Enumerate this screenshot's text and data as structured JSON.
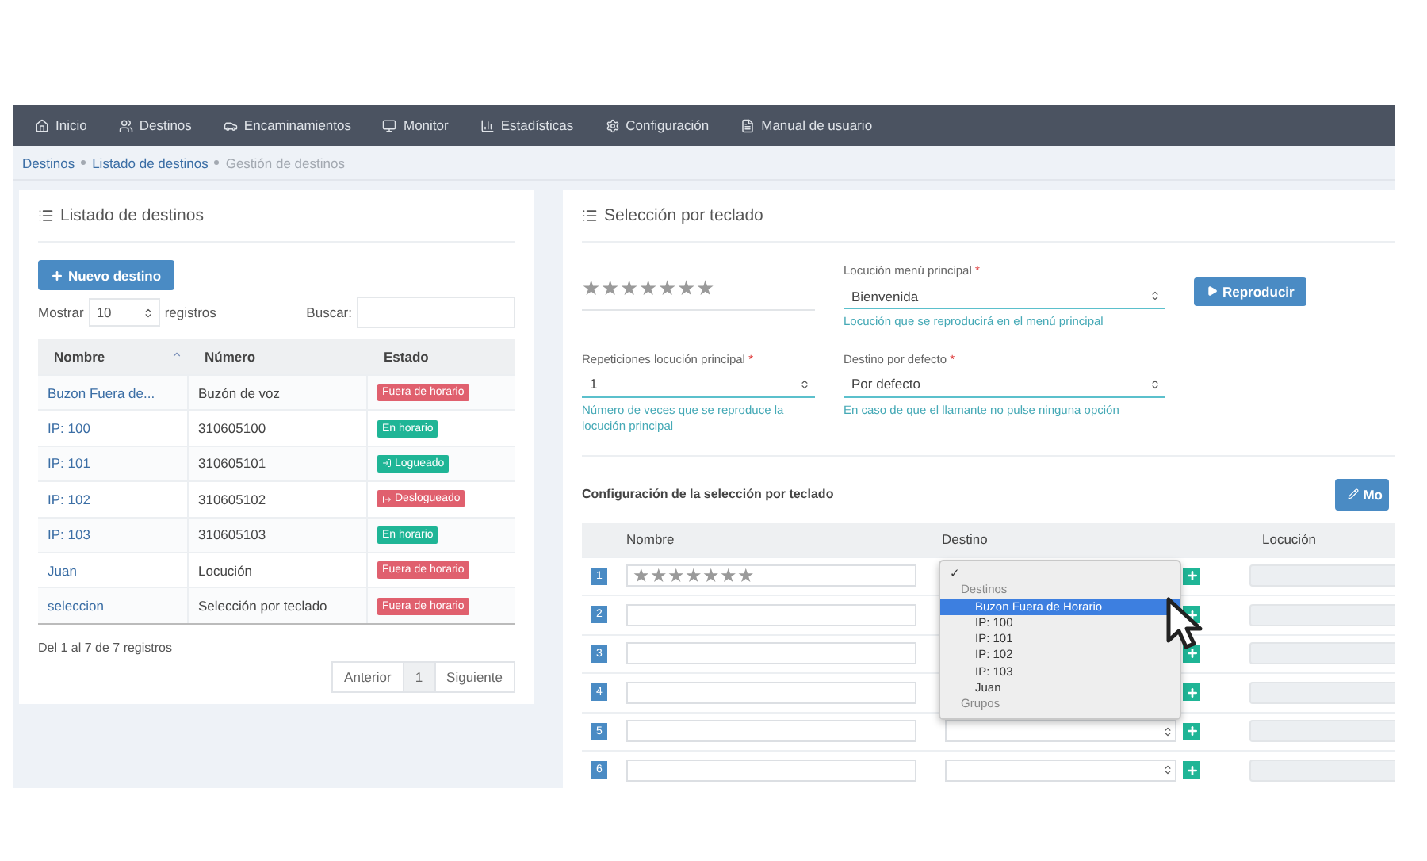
{
  "nav": [
    {
      "label": "Inicio"
    },
    {
      "label": "Destinos"
    },
    {
      "label": "Encaminamientos"
    },
    {
      "label": "Monitor"
    },
    {
      "label": "Estadísticas"
    },
    {
      "label": "Configuración"
    },
    {
      "label": "Manual de usuario"
    }
  ],
  "breadcrumb": [
    {
      "label": "Destinos",
      "current": false
    },
    {
      "label": "Listado de destinos",
      "current": false
    },
    {
      "label": "Gestión de destinos",
      "current": true
    }
  ],
  "list_panel": {
    "title": "Listado de destinos",
    "new_button": "Nuevo destino",
    "show_label": "Mostrar",
    "page_size": "10",
    "records_label": "registros",
    "search_label": "Buscar:",
    "columns": [
      "Nombre",
      "Número",
      "Estado"
    ],
    "rows": [
      {
        "name": "Buzon Fuera de...",
        "number": "Buzón de voz",
        "status": "Fuera de horario",
        "kind": "plain",
        "color": "#e0606e"
      },
      {
        "name": "IP: 100",
        "number": "310605100",
        "status": "En horario",
        "kind": "plain",
        "color": "#1fb596"
      },
      {
        "name": "IP: 101",
        "number": "310605101",
        "status": "Logueado",
        "kind": "login",
        "color": "#1fb596"
      },
      {
        "name": "IP: 102",
        "number": "310605102",
        "status": "Deslogueado",
        "kind": "logout",
        "color": "#e0606e"
      },
      {
        "name": "IP: 103",
        "number": "310605103",
        "status": "En horario",
        "kind": "plain",
        "color": "#1fb596"
      },
      {
        "name": "Juan",
        "number": "Locución",
        "status": "Fuera de horario",
        "kind": "plain",
        "color": "#e0606e"
      },
      {
        "name": "seleccion",
        "number": "Selección por teclado",
        "status": "Fuera de horario",
        "kind": "plain",
        "color": "#e0606e"
      }
    ],
    "info": "Del 1 al 7 de 7 registros",
    "pagination": [
      {
        "label": "Anterior",
        "selected": false
      },
      {
        "label": "1",
        "selected": true
      },
      {
        "label": "Siguiente",
        "selected": false
      }
    ]
  },
  "keypad_panel": {
    "title": "Selección por teclado",
    "name_value": "★★★★★★★",
    "menu_locution": {
      "label": "Locución menú principal",
      "required_mark": "*",
      "value": "Bienvenida",
      "help": "Locución que se reproducirá en el menú principal"
    },
    "play_button": "Reproducir",
    "repetitions": {
      "label": "Repeticiones locución principal",
      "required_mark": "*",
      "value": "1",
      "help": "Número de veces que se reproduce la locución principal"
    },
    "default_destination": {
      "label": "Destino por defecto",
      "required_mark": "*",
      "value": "Por defecto",
      "help": "En caso de que el llamante no pulse ninguna opción"
    },
    "config_title": "Configuración de la selección por teclado",
    "modify_button": "Mo",
    "columns": [
      "Nombre",
      "Destino",
      "Locución"
    ],
    "keys": [
      {
        "number": "1",
        "name": "★★★★★★★"
      },
      {
        "number": "2"
      },
      {
        "number": "3"
      },
      {
        "number": "4"
      },
      {
        "number": "5"
      },
      {
        "number": "6"
      }
    ],
    "dropdown": [
      {
        "kind": "check",
        "label": "✓",
        "selected": false
      },
      {
        "kind": "group",
        "label": "Destinos",
        "selected": false
      },
      {
        "kind": "option",
        "label": "Buzon Fuera de Horario",
        "selected": true
      },
      {
        "kind": "option",
        "label": "IP: 100",
        "selected": false
      },
      {
        "kind": "option",
        "label": "IP: 101",
        "selected": false
      },
      {
        "kind": "option",
        "label": "IP: 102",
        "selected": false
      },
      {
        "kind": "option",
        "label": "IP: 103",
        "selected": false
      },
      {
        "kind": "option",
        "label": "Juan",
        "selected": false
      },
      {
        "kind": "group",
        "label": "Grupos",
        "selected": false
      }
    ]
  }
}
